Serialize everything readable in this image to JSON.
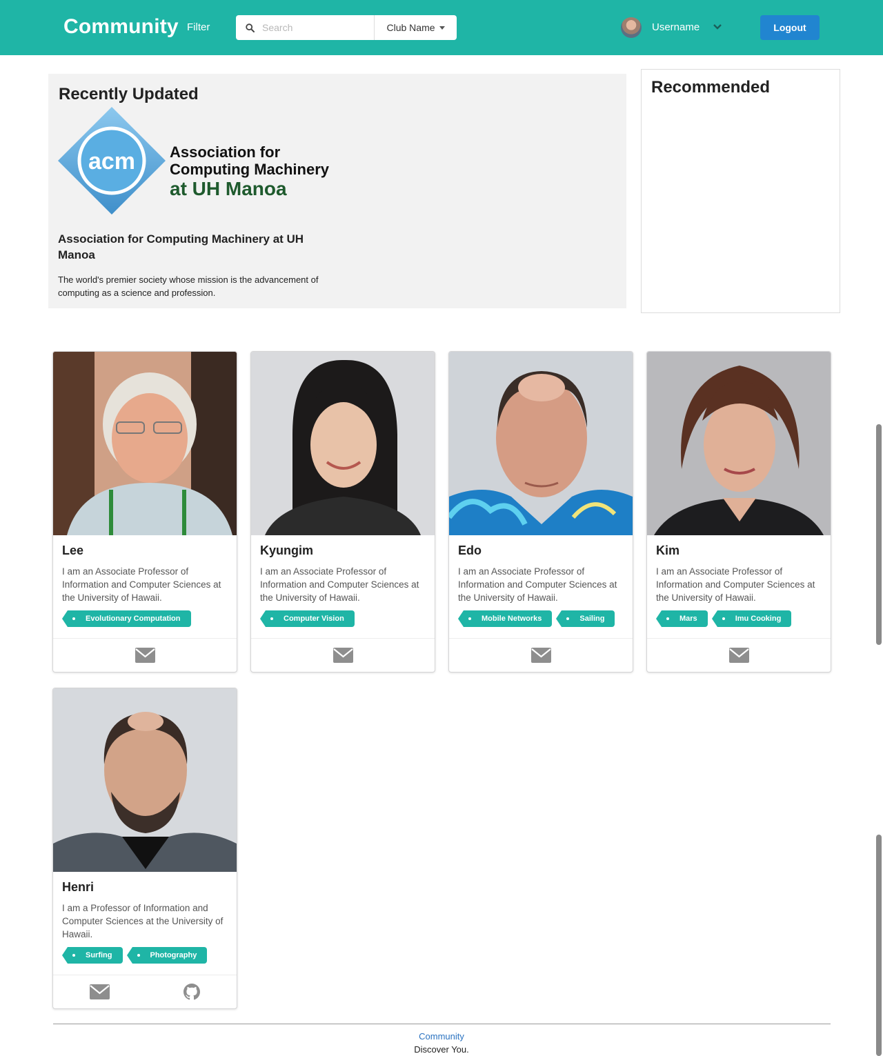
{
  "navbar": {
    "brand": "Community",
    "filter_label": "Filter",
    "search_placeholder": "Search",
    "club_select": "Club Name",
    "username": "Username",
    "logout_label": "Logout",
    "color": "#1fb5a6"
  },
  "recent": {
    "heading": "Recently Updated",
    "logo": {
      "text": "acm",
      "line1": "Association for",
      "line2": "Computing Machinery",
      "line3": "at UH Manoa"
    },
    "club_name": "Association for Computing Machinery at UH Manoa",
    "description": "The world's premier society whose mission is the advancement of computing as a science and profession."
  },
  "recommended": {
    "heading": "Recommended"
  },
  "profiles": [
    {
      "name": "Lee",
      "bio": "I am an Associate Professor of Information and Computer Sciences at the University of Hawaii.",
      "tags": [
        "Evolutionary Computation"
      ],
      "links": [
        "envelope-icon"
      ]
    },
    {
      "name": "Kyungim",
      "bio": "I am an Associate Professor of Information and Computer Sciences at the University of Hawaii.",
      "tags": [
        "Computer Vision"
      ],
      "links": [
        "envelope-icon"
      ]
    },
    {
      "name": "Edo",
      "bio": "I am an Associate Professor of Information and Computer Sciences at the University of Hawaii.",
      "tags": [
        "Mobile Networks",
        "Sailing"
      ],
      "links": [
        "envelope-icon"
      ]
    },
    {
      "name": "Kim",
      "bio": "I am an Associate Professor of Information and Computer Sciences at the University of Hawaii.",
      "tags": [
        "Mars",
        "Imu Cooking"
      ],
      "links": [
        "envelope-icon"
      ]
    },
    {
      "name": "Henri",
      "bio": "I am a Professor of Information and Computer Sciences at the University of Hawaii.",
      "tags": [
        "Surfing",
        "Photography"
      ],
      "links": [
        "envelope-icon",
        "github-icon"
      ]
    }
  ],
  "footer": {
    "link": "Community",
    "tagline": "Discover You."
  }
}
